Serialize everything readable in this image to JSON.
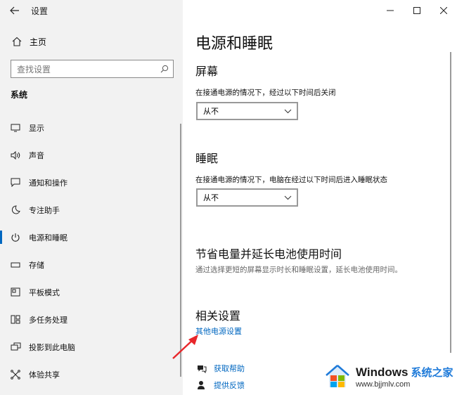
{
  "window": {
    "title": "设置",
    "back_icon": "arrow-left-icon",
    "controls": [
      "minimize-icon",
      "maximize-icon",
      "close-icon"
    ]
  },
  "sidebar": {
    "home_label": "主页",
    "search_placeholder": "查找设置",
    "section": "系统",
    "items": [
      {
        "label": "显示",
        "icon": "monitor-icon"
      },
      {
        "label": "声音",
        "icon": "speaker-icon"
      },
      {
        "label": "通知和操作",
        "icon": "message-icon"
      },
      {
        "label": "专注助手",
        "icon": "moon-icon"
      },
      {
        "label": "电源和睡眠",
        "icon": "power-icon",
        "active": true
      },
      {
        "label": "存储",
        "icon": "drive-icon"
      },
      {
        "label": "平板模式",
        "icon": "tablet-icon"
      },
      {
        "label": "多任务处理",
        "icon": "multitask-icon"
      },
      {
        "label": "投影到此电脑",
        "icon": "project-icon"
      },
      {
        "label": "体验共享",
        "icon": "share-icon"
      }
    ]
  },
  "main": {
    "title": "电源和睡眠",
    "screen": {
      "heading": "屏幕",
      "desc": "在接通电源的情况下，经过以下时间后关闭",
      "value": "从不"
    },
    "sleep": {
      "heading": "睡眠",
      "desc": "在接通电源的情况下，电脑在经过以下时间后进入睡眠状态",
      "value": "从不"
    },
    "battery": {
      "heading": "节省电量并延长电池使用时间",
      "desc": "通过选择更短的屏幕显示时长和睡眠设置，延长电池使用时间。"
    },
    "related": {
      "heading": "相关设置",
      "link": "其他电源设置"
    },
    "help": [
      {
        "label": "获取帮助",
        "icon": "help-chat-icon"
      },
      {
        "label": "提供反馈",
        "icon": "feedback-icon"
      }
    ]
  },
  "watermark": {
    "brand": "Windows",
    "cn": "系统之家",
    "url": "www.bjjmlv.com"
  },
  "colors": {
    "accent": "#0067c0",
    "sidebar_bg": "#f2f2f2",
    "annotation": "#e8262a"
  }
}
